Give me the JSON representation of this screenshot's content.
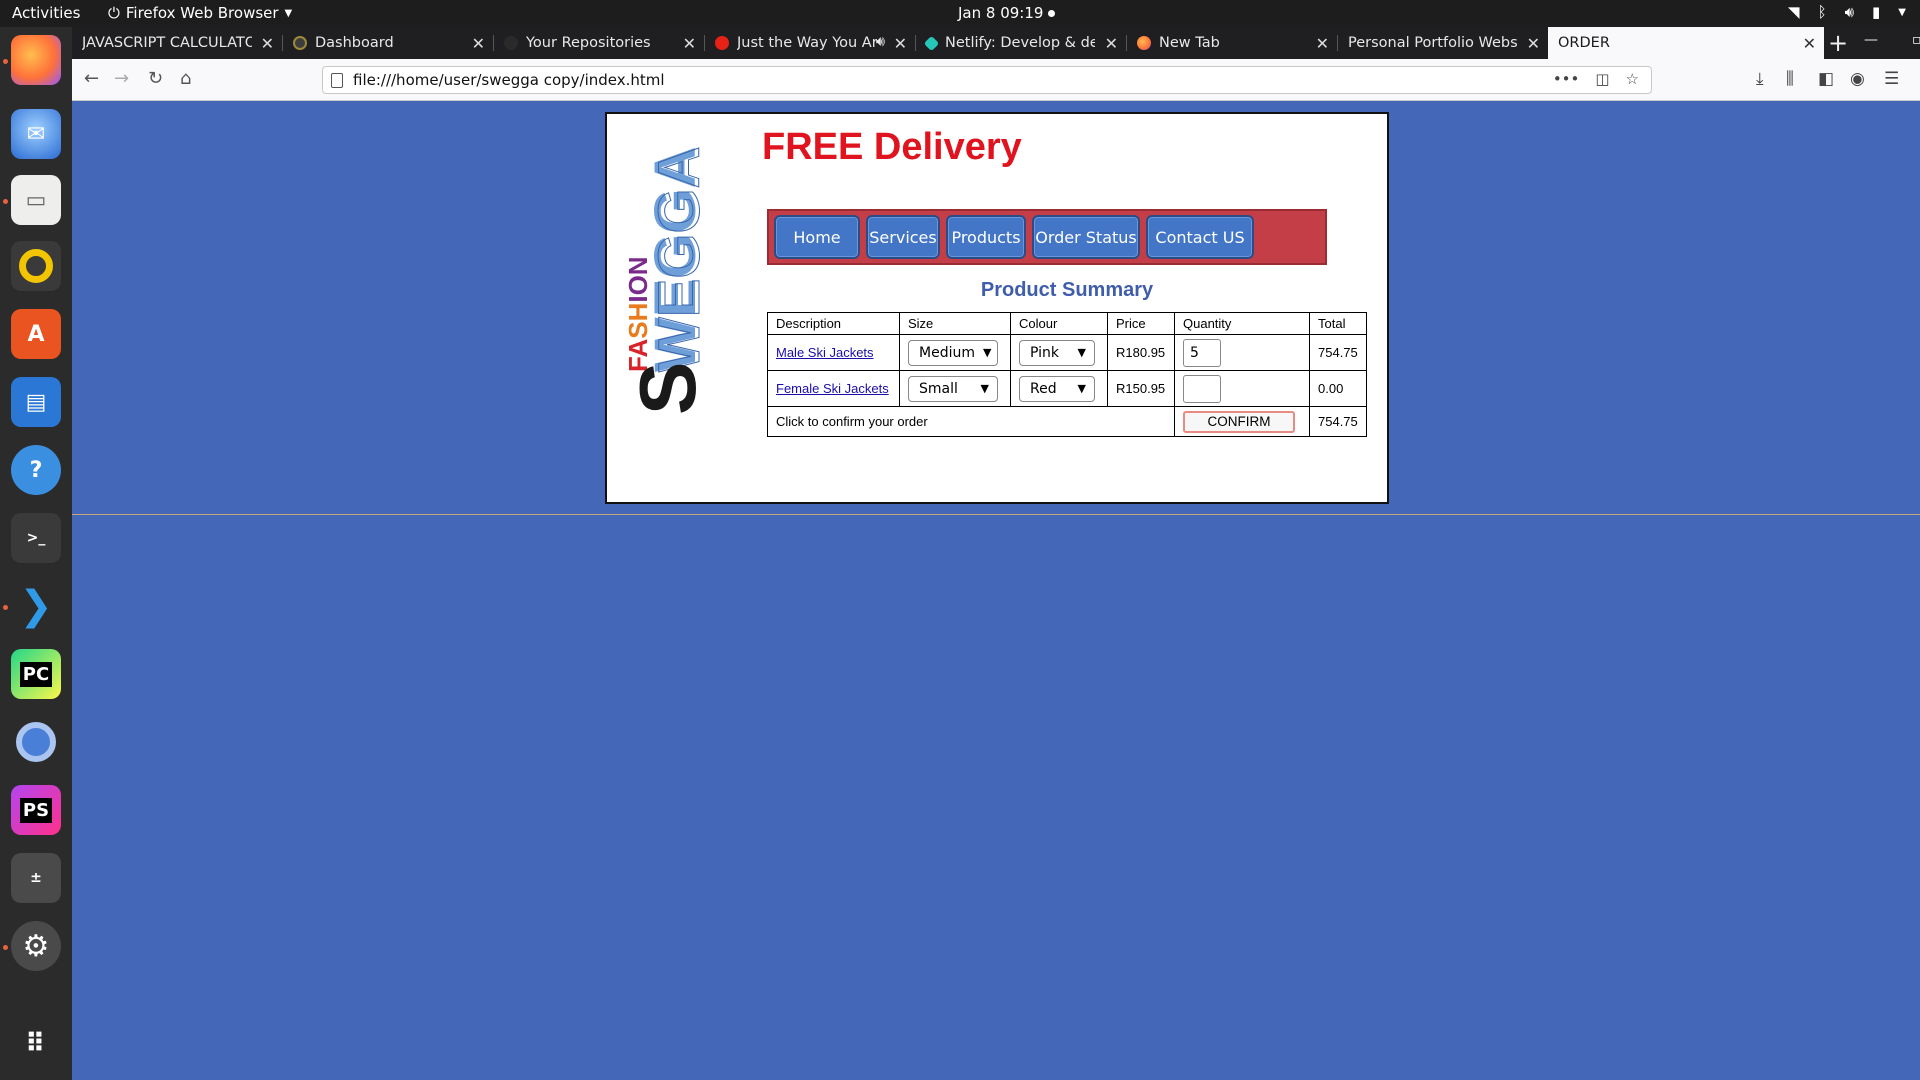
{
  "top_panel": {
    "activities": "Activities",
    "app_name": "Firefox Web Browser",
    "clock": "Jan 8  09:19"
  },
  "dock": {
    "items": [
      "firefox",
      "thunderbird",
      "files",
      "rhythmbox",
      "software-center",
      "writer",
      "help",
      "terminal",
      "vscode",
      "pycharm",
      "chromium",
      "phpstorm",
      "calculator",
      "settings",
      "show-apps"
    ]
  },
  "browser": {
    "tabs": [
      {
        "title": "JAVASCRIPT CALCULATOR"
      },
      {
        "title": "Dashboard"
      },
      {
        "title": "Your Repositories"
      },
      {
        "title": "Just the Way You Ar"
      },
      {
        "title": "Netlify: Develop & dep"
      },
      {
        "title": "New Tab"
      },
      {
        "title": "Personal Portfolio Websi"
      },
      {
        "title": "ORDER"
      }
    ],
    "url": "file:///home/user/swegga copy/index.html"
  },
  "page": {
    "logo": {
      "line1": "FASHION",
      "line2": "SWEGGA"
    },
    "headline": "FREE Delivery",
    "nav": [
      "Home",
      "Services",
      "Products",
      "Order Status",
      "Contact US"
    ],
    "summary_title": "Product Summary",
    "table": {
      "headers": [
        "Description",
        "Size",
        "Colour",
        "Price",
        "Quantity",
        "Total"
      ],
      "rows": [
        {
          "description": "Male Ski Jackets",
          "size": "Medium",
          "colour": "Pink",
          "price": "R180.95",
          "quantity": "5",
          "total": "754.75"
        },
        {
          "description": "Female Ski Jackets",
          "size": "Small",
          "colour": "Red",
          "price": "R150.95",
          "quantity": "",
          "total": "0.00"
        }
      ],
      "confirm_text": "Click to confirm your order",
      "confirm_button": "CONFIRM",
      "grand_total": "754.75"
    }
  },
  "colors": {
    "page_background": "#4567b8",
    "headline": "#e0141f",
    "nav_strip": "#c43e47",
    "nav_pill": "#4476c7",
    "summary_title": "#3f5dab"
  }
}
